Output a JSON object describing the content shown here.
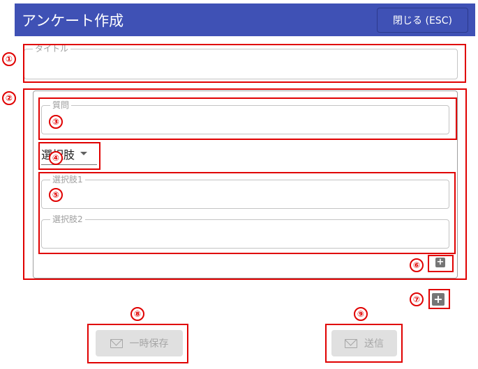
{
  "header": {
    "title": "アンケート作成",
    "close_label": "閉じる (ESC)"
  },
  "form": {
    "title_label": "タイトル",
    "question_label": "質問",
    "answer_type": "選択肢",
    "choices": [
      {
        "label": "選択肢1"
      },
      {
        "label": "選択肢2"
      }
    ]
  },
  "buttons": {
    "save_draft": "一時保存",
    "send": "送信"
  },
  "annotations": [
    "①",
    "②",
    "③",
    "④",
    "⑤",
    "⑥",
    "⑦",
    "⑧",
    "⑨"
  ],
  "colors": {
    "app_bar": "#3f51b5",
    "annotation": "#e00000",
    "disabled_button": "#e0e0e0"
  },
  "icons": {
    "add": "plus-icon",
    "mail": "mail-icon",
    "dropdown": "caret-down-icon"
  }
}
